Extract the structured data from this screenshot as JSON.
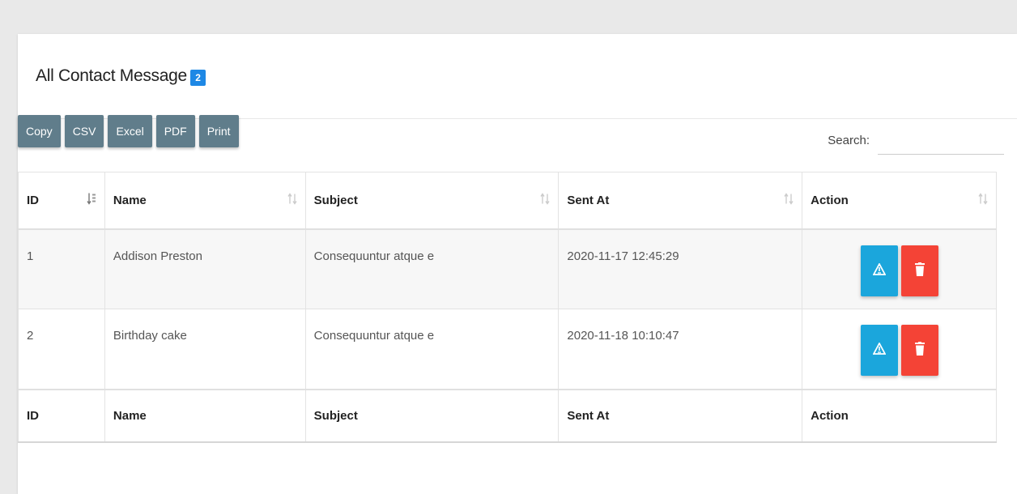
{
  "header": {
    "title": "All Contact Message",
    "count_badge": "2"
  },
  "toolbar": {
    "buttons": [
      "Copy",
      "CSV",
      "Excel",
      "PDF",
      "Print"
    ]
  },
  "search": {
    "label": "Search:",
    "value": ""
  },
  "table": {
    "columns": [
      "ID",
      "Name",
      "Subject",
      "Sent At",
      "Action"
    ],
    "rows": [
      {
        "id": "1",
        "name": "Addison Preston",
        "subject": "Consequuntur atque e",
        "sent_at": "2020-11-17 12:45:29"
      },
      {
        "id": "2",
        "name": "Birthday cake",
        "subject": "Consequuntur atque e",
        "sent_at": "2020-11-18 10:10:47"
      }
    ],
    "footer": [
      "ID",
      "Name",
      "Subject",
      "Sent At",
      "Action"
    ]
  },
  "icons": {
    "view": "warning-triangle-icon",
    "delete": "trash-icon",
    "sort": "sort-icon"
  },
  "colors": {
    "toolbar_button": "#607d8b",
    "badge": "#1e88e5",
    "view_button": "#1ba6dc",
    "delete_button": "#f44336"
  }
}
